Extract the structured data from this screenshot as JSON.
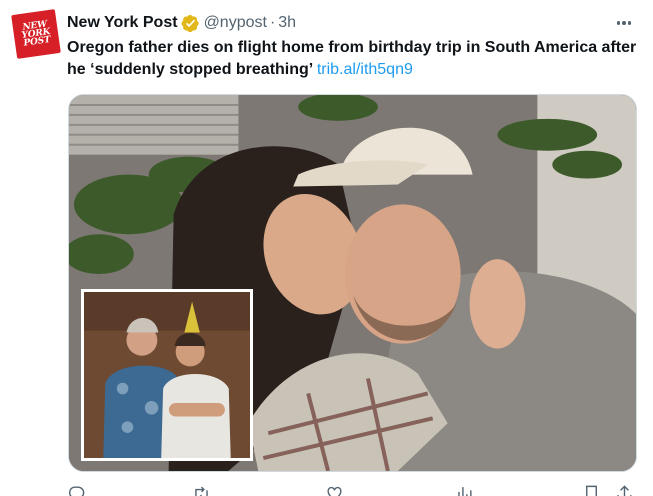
{
  "account": {
    "avatar_lines": [
      "NEW",
      "YORK",
      "POST"
    ],
    "display_name": "New York Post",
    "handle": "@nypost",
    "separator": "·",
    "time": "3h",
    "verified_color": "#e2b719"
  },
  "tweet": {
    "text": "Oregon father dies on flight home from birthday trip in South America after he ‘suddenly stopped breathing’",
    "link_text": "trib.al/ith5qn9",
    "link_color": "#1d9bf0"
  },
  "media": {
    "main_photo": "couple-photo",
    "inset_photo": "father-son-photo"
  },
  "actions": {
    "reply_count": "",
    "retweet_count": "",
    "like_count": "",
    "views_count": ""
  },
  "icons": {
    "more": "more-icon",
    "reply": "reply-icon",
    "retweet": "retweet-icon",
    "like": "like-icon",
    "views": "views-icon",
    "bookmark": "bookmark-icon",
    "share": "share-icon"
  },
  "colors": {
    "brand_red": "#d61f26",
    "text_primary": "#0f1419",
    "text_secondary": "#536471"
  }
}
